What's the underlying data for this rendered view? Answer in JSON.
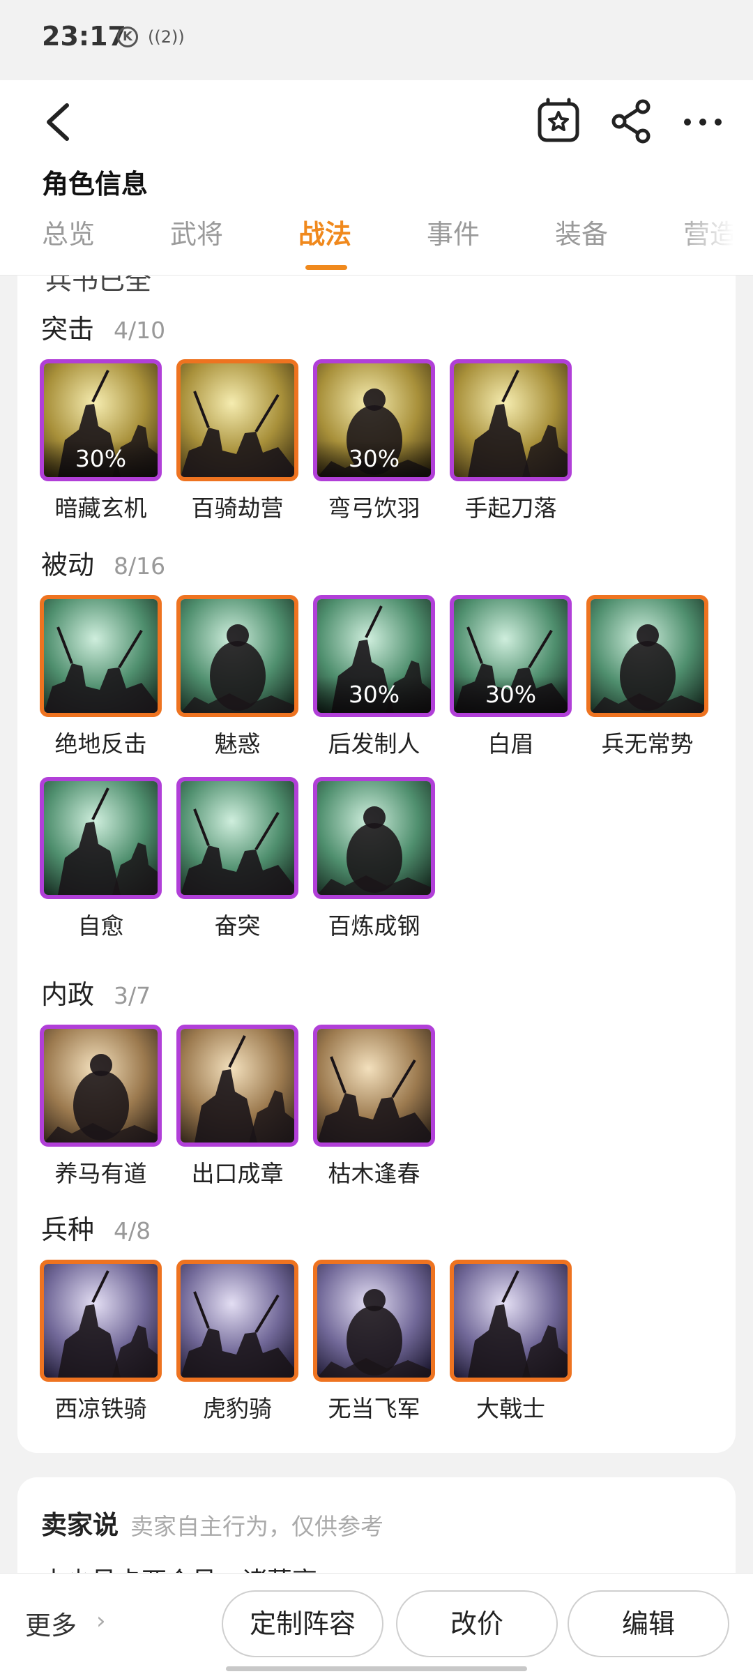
{
  "status_bar": {
    "time": "23:17",
    "icon1": "K",
    "icon2": "((2))"
  },
  "header": {
    "title": "角色信息",
    "icons": {
      "back": "back-arrow-icon",
      "favorite": "star-bookmark-icon",
      "share": "share-icon",
      "more": "more-dots-icon"
    }
  },
  "tabs": [
    {
      "label": "总览"
    },
    {
      "label": "武将"
    },
    {
      "label": "战法"
    },
    {
      "label": "事件"
    },
    {
      "label": "装备"
    },
    {
      "label": "营造"
    }
  ],
  "active_tab": "战法",
  "colors": {
    "accent": "#f0891d",
    "purple_frame": "#b13fd8",
    "orange_frame": "#ee7320"
  },
  "cut_text": "兵书已全",
  "sections": [
    {
      "title": "突击",
      "count": "4/10",
      "skills": [
        {
          "name": "暗藏玄机",
          "frame": "purple",
          "pct": "30%",
          "theme": "gold"
        },
        {
          "name": "百骑劫营",
          "frame": "orange",
          "pct": "",
          "theme": "gold"
        },
        {
          "name": "弯弓饮羽",
          "frame": "purple",
          "pct": "30%",
          "theme": "gold"
        },
        {
          "name": "手起刀落",
          "frame": "purple",
          "pct": "",
          "theme": "gold"
        }
      ]
    },
    {
      "title": "被动",
      "count": "8/16",
      "skills": [
        {
          "name": "绝地反击",
          "frame": "orange",
          "pct": "",
          "theme": "green"
        },
        {
          "name": "魅惑",
          "frame": "orange",
          "pct": "",
          "theme": "green"
        },
        {
          "name": "后发制人",
          "frame": "purple",
          "pct": "30%",
          "theme": "green"
        },
        {
          "name": "白眉",
          "frame": "purple",
          "pct": "30%",
          "theme": "green"
        },
        {
          "name": "兵无常势",
          "frame": "orange",
          "pct": "",
          "theme": "green"
        },
        {
          "name": "自愈",
          "frame": "purple",
          "pct": "",
          "theme": "green"
        },
        {
          "name": "奋突",
          "frame": "purple",
          "pct": "",
          "theme": "green"
        },
        {
          "name": "百炼成钢",
          "frame": "purple",
          "pct": "",
          "theme": "green"
        }
      ]
    },
    {
      "title": "内政",
      "count": "3/7",
      "skills": [
        {
          "name": "养马有道",
          "frame": "purple",
          "pct": "",
          "theme": "tan"
        },
        {
          "name": "出口成章",
          "frame": "purple",
          "pct": "",
          "theme": "tan"
        },
        {
          "name": "枯木逢春",
          "frame": "purple",
          "pct": "",
          "theme": "tan"
        }
      ]
    },
    {
      "title": "兵种",
      "count": "4/8",
      "skills": [
        {
          "name": "西凉铁骑",
          "frame": "orange",
          "pct": "",
          "theme": "violet"
        },
        {
          "name": "虎豹骑",
          "frame": "orange",
          "pct": "",
          "theme": "violet"
        },
        {
          "name": "无当飞军",
          "frame": "orange",
          "pct": "",
          "theme": "violet"
        },
        {
          "name": "大戟士",
          "frame": "orange",
          "pct": "",
          "theme": "violet"
        }
      ]
    }
  ],
  "seller": {
    "title": "卖家说",
    "note": "卖家自主行为，仅供参考",
    "line": "本少号卡两个号，诸葛亮"
  },
  "bottom_bar": {
    "more_label": "更多",
    "buttons": [
      {
        "label": "定制阵容"
      },
      {
        "label": "改价"
      },
      {
        "label": "编辑"
      }
    ]
  }
}
